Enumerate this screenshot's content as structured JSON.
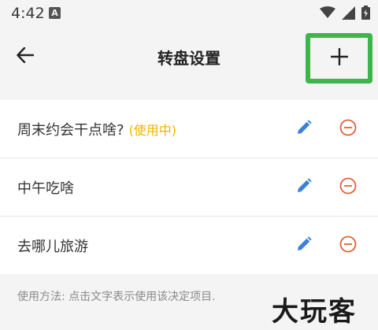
{
  "status_bar": {
    "time": "4:42",
    "notification_badge": "A"
  },
  "app_bar": {
    "title": "转盘设置",
    "back_icon": "arrow-left-icon",
    "add_icon": "plus-icon"
  },
  "list": {
    "items": [
      {
        "label": "周末约会干点啥?",
        "status": "(使用中)"
      },
      {
        "label": "中午吃啥",
        "status": ""
      },
      {
        "label": "去哪儿旅游",
        "status": ""
      }
    ]
  },
  "help_text": "使用方法: 点击文字表示使用该决定项目.",
  "watermark": "大玩客",
  "colors": {
    "accent_edit": "#3b82d6",
    "accent_remove": "#e0603a",
    "in_use": "#f0b400",
    "highlight_box": "#3cb64a"
  }
}
